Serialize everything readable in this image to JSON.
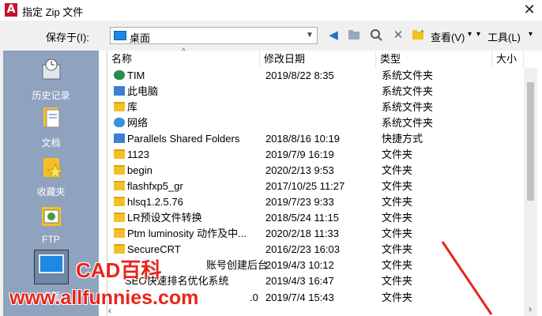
{
  "window": {
    "title": "指定 Zip 文件",
    "close_glyph": "✕",
    "app_icon_letter": "A"
  },
  "toolbar": {
    "save_in_label": "保存于(I):",
    "location": "桌面",
    "view_label": "查看(V)",
    "tools_label": "工具(L)"
  },
  "places": [
    {
      "label": "历史记录",
      "icon": "history-icon"
    },
    {
      "label": "文档",
      "icon": "documents-icon"
    },
    {
      "label": "收藏夹",
      "icon": "favorites-icon"
    },
    {
      "label": "FTP",
      "icon": "ftp-icon"
    },
    {
      "label": "桌面",
      "icon": "desktop-icon"
    }
  ],
  "columns": {
    "name": "名称",
    "date": "修改日期",
    "type": "类型",
    "size": "大小"
  },
  "files": [
    {
      "name": "TIM",
      "date": "2019/8/22 8:35",
      "type": "系统文件夹",
      "icon": "tim-icon"
    },
    {
      "name": "此电脑",
      "date": "",
      "type": "系统文件夹",
      "icon": "computer-icon"
    },
    {
      "name": "库",
      "date": "",
      "type": "系统文件夹",
      "icon": "library-icon"
    },
    {
      "name": "网络",
      "date": "",
      "type": "系统文件夹",
      "icon": "network-icon"
    },
    {
      "name": "Parallels Shared Folders",
      "date": "2018/8/16 10:19",
      "type": "快捷方式",
      "icon": "shortcut-icon"
    },
    {
      "name": "1123",
      "date": "2019/7/9 16:19",
      "type": "文件夹",
      "icon": "folder-icon"
    },
    {
      "name": "begin",
      "date": "2020/2/13 9:53",
      "type": "文件夹",
      "icon": "folder-icon"
    },
    {
      "name": "flashfxp5_gr",
      "date": "2017/10/25 11:27",
      "type": "文件夹",
      "icon": "folder-icon"
    },
    {
      "name": "hlsq1.2.5.76",
      "date": "2019/7/23 9:33",
      "type": "文件夹",
      "icon": "folder-icon"
    },
    {
      "name": "LR预设文件转换",
      "date": "2018/5/24 11:15",
      "type": "文件夹",
      "icon": "folder-icon"
    },
    {
      "name": "Ptm luminosity 动作及中...",
      "date": "2020/2/18 11:33",
      "type": "文件夹",
      "icon": "folder-icon"
    },
    {
      "name": "SecureCRT",
      "date": "2016/2/23 16:03",
      "type": "文件夹",
      "icon": "folder-icon"
    },
    {
      "name": "账号创建后台",
      "date": "2019/4/3 10:12",
      "type": "文件夹",
      "icon": "folder-icon"
    },
    {
      "name": "SEO快速排名优化系统",
      "date": "2019/4/3 16:47",
      "type": "文件夹",
      "icon": "folder-icon"
    },
    {
      "name": ".0",
      "date": "2019/7/4 15:43",
      "type": "文件夹",
      "icon": "folder-icon"
    }
  ],
  "watermark": {
    "line1": "CAD百科",
    "line2": "www.allfunnies.com"
  },
  "colors": {
    "places_bg": "#8fa3bf",
    "folder": "#f5c023",
    "watermark": "#e8251b",
    "arrow": "#e8251b"
  }
}
